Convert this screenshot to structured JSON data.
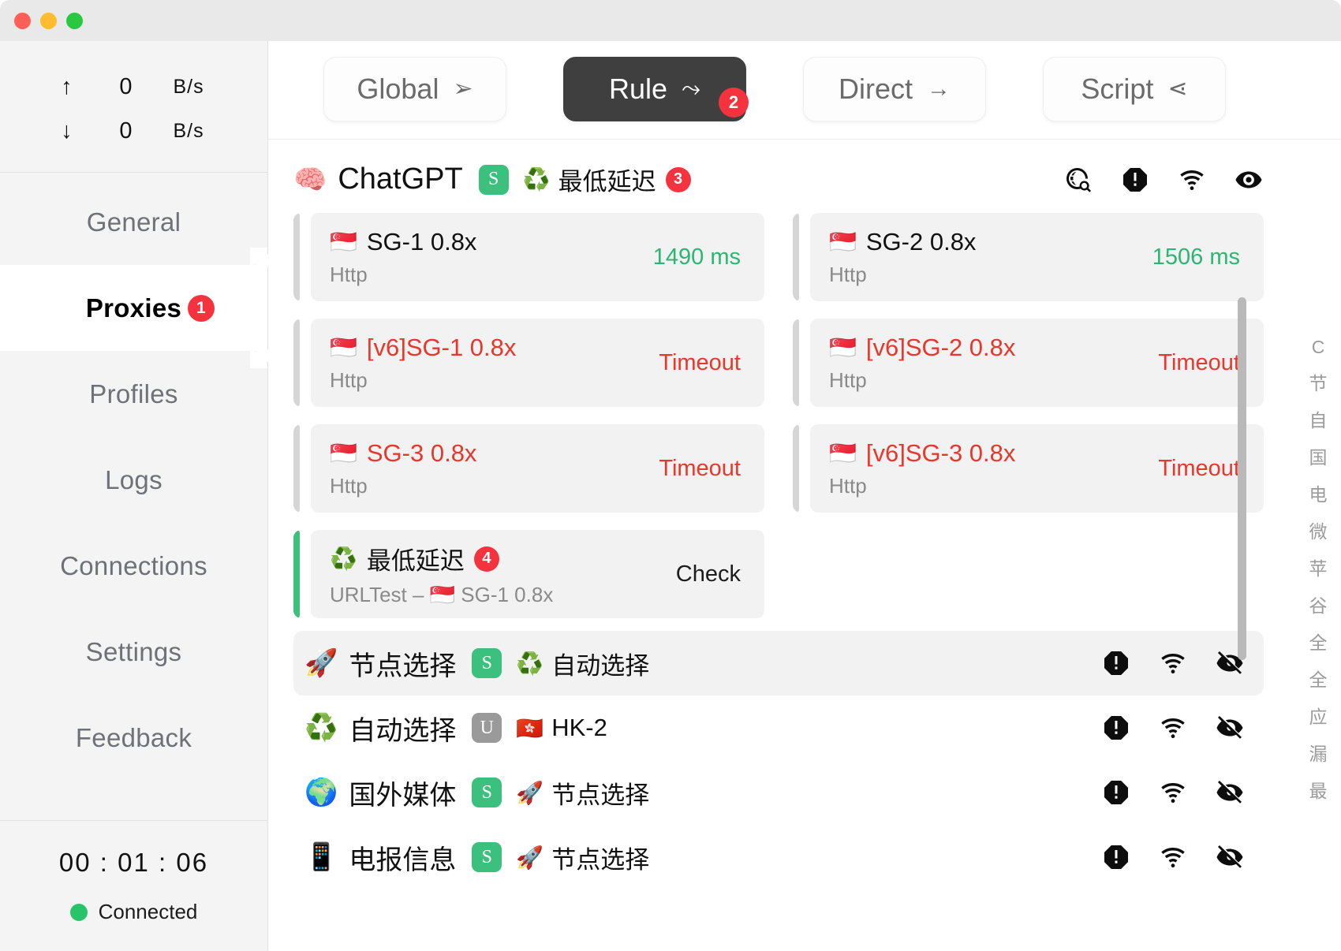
{
  "titlebar": {
    "close": "close",
    "minimize": "minimize",
    "maximize": "maximize"
  },
  "sidebar": {
    "traffic": {
      "upload": {
        "arrow": "↑",
        "value": "0",
        "unit": "B/s"
      },
      "download": {
        "arrow": "↓",
        "value": "0",
        "unit": "B/s"
      }
    },
    "items": [
      {
        "label": "General",
        "badge": ""
      },
      {
        "label": "Proxies",
        "badge": "1"
      },
      {
        "label": "Profiles",
        "badge": ""
      },
      {
        "label": "Logs",
        "badge": ""
      },
      {
        "label": "Connections",
        "badge": ""
      },
      {
        "label": "Settings",
        "badge": ""
      },
      {
        "label": "Feedback",
        "badge": ""
      }
    ],
    "footer": {
      "timer": "00 : 01 : 06",
      "status": "Connected"
    }
  },
  "modebar": {
    "modes": [
      {
        "label": "Global",
        "icon": "➢",
        "badge": "",
        "active": false
      },
      {
        "label": "Rule",
        "icon": "⤳",
        "badge": "2",
        "active": true
      },
      {
        "label": "Direct",
        "icon": "→",
        "badge": "",
        "active": false
      },
      {
        "label": "Script",
        "icon": "⋖",
        "badge": "",
        "active": false
      }
    ]
  },
  "group": {
    "emoji": "🧠",
    "title": "ChatGPT",
    "type_badge": "S",
    "select_emoji": "♻️",
    "selected": "最低延迟",
    "count": "3",
    "actions": [
      "globe-search-icon",
      "alert-octagon-icon",
      "speed-test-icon",
      "eye-icon"
    ]
  },
  "nodes": [
    {
      "flag": "🇸🇬",
      "name": "SG-1 0.8x",
      "proto": "Http",
      "latency": "1490 ms",
      "state": "ok",
      "selected": false
    },
    {
      "flag": "🇸🇬",
      "name": "SG-2 0.8x",
      "proto": "Http",
      "latency": "1506 ms",
      "state": "ok",
      "selected": false
    },
    {
      "flag": "🇸🇬",
      "name": "[v6]SG-1 0.8x",
      "proto": "Http",
      "latency": "Timeout",
      "state": "timeout",
      "selected": false
    },
    {
      "flag": "🇸🇬",
      "name": "[v6]SG-2 0.8x",
      "proto": "Http",
      "latency": "Timeout",
      "state": "timeout",
      "selected": false
    },
    {
      "flag": "🇸🇬",
      "name": "SG-3 0.8x",
      "proto": "Http",
      "latency": "Timeout",
      "state": "timeout",
      "selected": false
    },
    {
      "flag": "🇸🇬",
      "name": "[v6]SG-3 0.8x",
      "proto": "Http",
      "latency": "Timeout",
      "state": "timeout",
      "selected": false
    }
  ],
  "urltest_node": {
    "flag": "♻️",
    "name": "最低延迟",
    "count": "4",
    "proto": "URLTest – 🇸🇬 SG-1 0.8x",
    "latency": "Check",
    "state": "check",
    "selected": true
  },
  "groups": [
    {
      "emoji": "🚀",
      "name": "节点选择",
      "badge": "S",
      "badge_kind": "s",
      "sel_emoji": "♻️",
      "selected": "自动选择",
      "highlight": true
    },
    {
      "emoji": "♻️",
      "name": "自动选择",
      "badge": "U",
      "badge_kind": "u",
      "sel_emoji": "🇭🇰",
      "selected": "HK-2",
      "highlight": false
    },
    {
      "emoji": "🌍",
      "name": "国外媒体",
      "badge": "S",
      "badge_kind": "s",
      "sel_emoji": "🚀",
      "selected": "节点选择",
      "highlight": false
    },
    {
      "emoji": "📱",
      "name": "电报信息",
      "badge": "S",
      "badge_kind": "s",
      "sel_emoji": "🚀",
      "selected": "节点选择",
      "highlight": false
    }
  ],
  "index_strip": [
    "C",
    "节",
    "自",
    "国",
    "电",
    "微",
    "苹",
    "谷",
    "全",
    "全",
    "应",
    "漏",
    "最"
  ],
  "colors": {
    "accent_red": "#f5333f",
    "ok_green": "#2bb673",
    "timeout_red": "#e8372b",
    "selected_bar": "#3cc07e",
    "active_mode_bg": "#3f3f3f"
  }
}
